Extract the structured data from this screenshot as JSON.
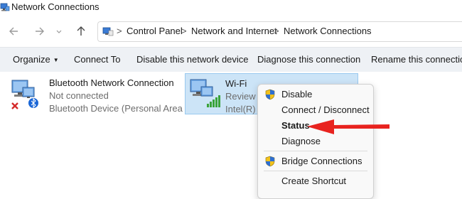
{
  "window": {
    "title": "Network Connections"
  },
  "address": {
    "breadcrumbs": [
      "Control Panel",
      "Network and Internet",
      "Network Connections"
    ]
  },
  "toolbar": {
    "organize": "Organize",
    "connect_to": "Connect To",
    "disable_device": "Disable this network device",
    "diagnose": "Diagnose this connection",
    "rename": "Rename this connection"
  },
  "connections": [
    {
      "name": "Bluetooth Network Connection",
      "status": "Not connected",
      "device": "Bluetooth Device (Personal Area ..."
    },
    {
      "name": "Wi-Fi",
      "status": "Review G",
      "device": "Intel(R) W"
    }
  ],
  "context_menu": {
    "items": [
      {
        "label": "Disable",
        "icon": "shield-icon"
      },
      {
        "label": "Connect / Disconnect"
      },
      {
        "label": "Status",
        "bold": true
      },
      {
        "label": "Diagnose"
      },
      {
        "label": "Bridge Connections",
        "icon": "shield-icon"
      },
      {
        "label": "Create Shortcut"
      }
    ]
  },
  "colors": {
    "selection_bg": "#cce4f7",
    "selection_border": "#99c9ef",
    "toolbar_bg": "#eef1f5",
    "arrow_red": "#e8231f"
  }
}
